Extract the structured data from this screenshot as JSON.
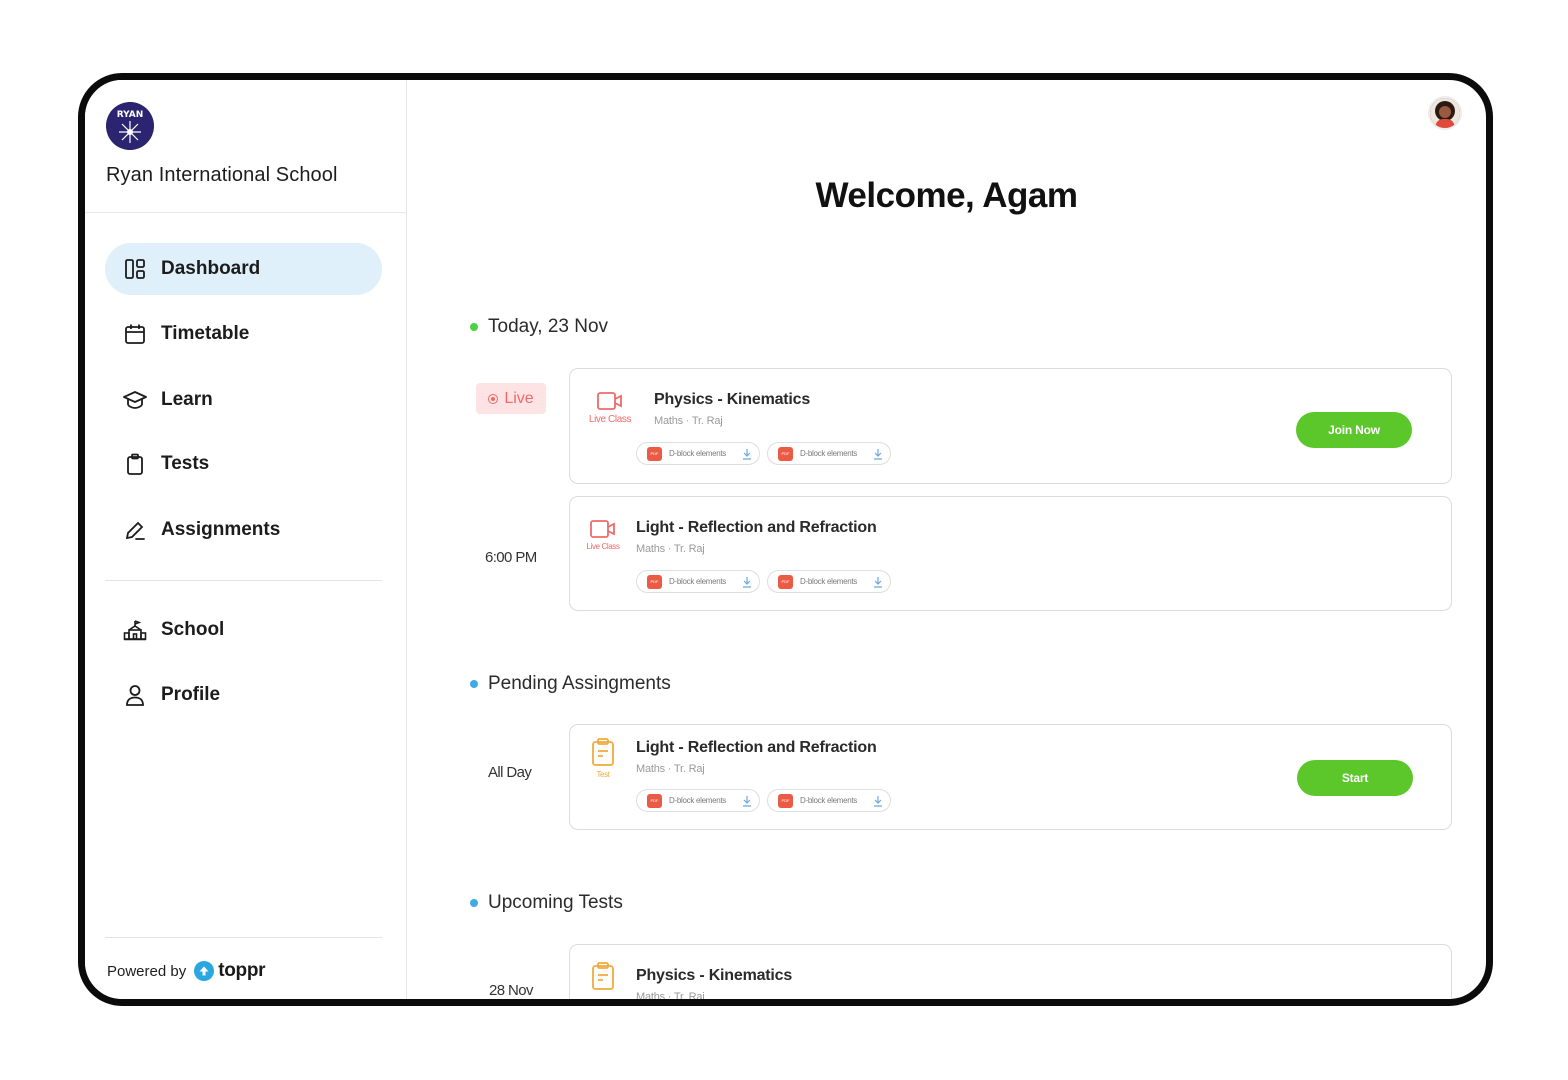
{
  "sidebar": {
    "school_logo_text": "RYAN",
    "school_name": "Ryan International School",
    "nav": [
      {
        "label": "Dashboard",
        "icon": "dashboard-icon",
        "active": true
      },
      {
        "label": "Timetable",
        "icon": "calendar-icon"
      },
      {
        "label": "Learn",
        "icon": "graduation-cap-icon"
      },
      {
        "label": "Tests",
        "icon": "clipboard-icon"
      },
      {
        "label": "Assignments",
        "icon": "pen-icon"
      },
      {
        "label": "School",
        "icon": "school-building-icon"
      },
      {
        "label": "Profile",
        "icon": "person-icon"
      }
    ],
    "powered_by": "Powered by",
    "brand": "toppr"
  },
  "header": {
    "welcome": "Welcome, Agam"
  },
  "sections": {
    "today": {
      "title": "Today, 23 Nov",
      "dot_color": "#4cd13f"
    },
    "assignments": {
      "title": "Pending Assingments",
      "dot_color": "#3fa9e6"
    },
    "tests": {
      "title": "Upcoming Tests",
      "dot_color": "#3fa9e6"
    }
  },
  "cards": [
    {
      "time": "Live",
      "type_label": "Live Class",
      "title": "Physics - Kinematics",
      "subtitle": "Maths · Tr. Raj",
      "attachments": [
        "D-block elements",
        "D-block elements"
      ],
      "action": "Join Now"
    },
    {
      "time": "6:00 PM",
      "type_label": "Live Class",
      "title": "Light - Reflection and Refraction",
      "subtitle": "Maths · Tr. Raj",
      "attachments": [
        "D-block elements",
        "D-block elements"
      ]
    },
    {
      "time": "All Day",
      "type_label": "Test",
      "title": "Light - Reflection and Refraction",
      "subtitle": "Maths · Tr. Raj",
      "attachments": [
        "D-block elements",
        "D-block elements"
      ],
      "action": "Start"
    },
    {
      "time": "28 Nov",
      "type_label": "",
      "title": "Physics - Kinematics",
      "subtitle": "Maths · Tr. Raj"
    }
  ],
  "pdf_label": "PDF",
  "colors": {
    "accent_green": "#5cc72b",
    "live_red": "#ef6a6a",
    "test_orange": "#f0a93a",
    "active_nav": "#dff0fb"
  }
}
